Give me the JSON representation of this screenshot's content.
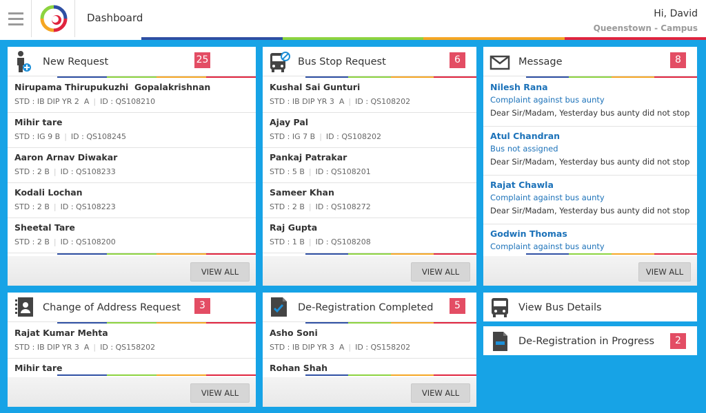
{
  "header": {
    "title": "Dashboard",
    "greeting": "Hi, David",
    "campus": "Queenstown - Campus"
  },
  "colors": {
    "blue_bg": "#17a3e6",
    "badge": "#e34d64",
    "stripe": [
      "#ffffff",
      "#2e4fa3",
      "#8cd33f",
      "#f5a623",
      "#e0243e"
    ]
  },
  "new_request": {
    "title": "New Request",
    "count": "25",
    "view_all": "VIEW ALL",
    "rows": [
      {
        "name": "Nirupama Thirupukuzhi  Gopalakrishnan",
        "std": "STD : IB DIP YR 2  A",
        "id": "ID : QS108210"
      },
      {
        "name": "Mihir tare",
        "std": "STD : IG 9 B",
        "id": "ID : QS108245"
      },
      {
        "name": "Aaron Arnav Diwakar",
        "std": "STD : 2 B",
        "id": "ID : QS108233"
      },
      {
        "name": "Kodali Lochan",
        "std": "STD : 2 B",
        "id": "ID : QS108223"
      },
      {
        "name": "Sheetal Tare",
        "std": "STD : 2 B",
        "id": "ID : QS108200"
      }
    ]
  },
  "bus_stop_request": {
    "title": "Bus Stop Request",
    "count": "6",
    "view_all": "VIEW ALL",
    "rows": [
      {
        "name": "Kushal Sai Gunturi",
        "std": "STD : IB DIP YR 3  A",
        "id": "ID : QS108202"
      },
      {
        "name": "Ajay Pal",
        "std": "STD : IG 7 B",
        "id": "ID : QS108202"
      },
      {
        "name": "Pankaj Patrakar",
        "std": "STD : 5 B",
        "id": "ID : QS108201"
      },
      {
        "name": "Sameer Khan",
        "std": "STD : 2 B",
        "id": "ID : QS108272"
      },
      {
        "name": "Raj Gupta",
        "std": "STD : 1 B",
        "id": "ID : QS108208"
      }
    ]
  },
  "message": {
    "title": "Message",
    "count": "8",
    "view_all": "VIEW ALL",
    "rows": [
      {
        "name": "Nilesh Rana",
        "subject": "Complaint against bus aunty",
        "body": "Dear Sir/Madam, Yesterday bus aunty did not stop..."
      },
      {
        "name": "Atul Chandran",
        "subject": "Bus not assigned",
        "body": "Dear Sir/Madam, Yesterday bus aunty did not stop..."
      },
      {
        "name": "Rajat Chawla",
        "subject": "Complaint against bus aunty",
        "body": "Dear Sir/Madam, Yesterday bus aunty did not stop..."
      },
      {
        "name": "Godwin Thomas",
        "subject": "Complaint against bus aunty",
        "body": ""
      }
    ]
  },
  "change_address": {
    "title": "Change of Address Request",
    "count": "3",
    "view_all": "VIEW ALL",
    "rows": [
      {
        "name": "Rajat Kumar Mehta",
        "std": "STD : IB DIP YR 3  A",
        "id": "ID : QS158202"
      },
      {
        "name": "Mihir tare",
        "std": "",
        "id": ""
      }
    ]
  },
  "dereg_completed": {
    "title": "De-Registration Completed",
    "count": "5",
    "view_all": "VIEW ALL",
    "rows": [
      {
        "name": "Asho Soni",
        "std": "STD : IB DIP YR 3  A",
        "id": "ID : QS158202"
      },
      {
        "name": "Rohan Shah",
        "std": "",
        "id": ""
      }
    ]
  },
  "view_bus_details": {
    "title": "View Bus Details"
  },
  "dereg_progress": {
    "title": "De-Registration in Progress",
    "count": "2"
  }
}
